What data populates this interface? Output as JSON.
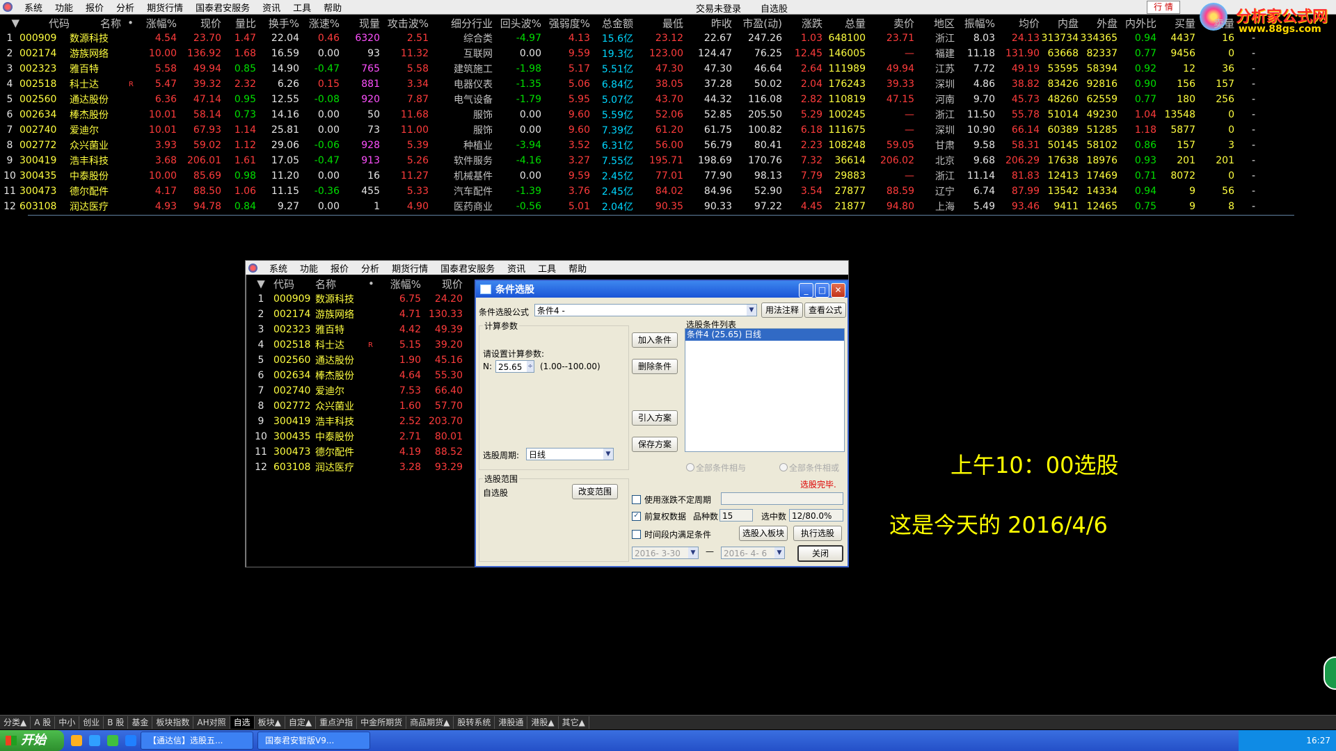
{
  "menubar": {
    "items": [
      "系统",
      "功能",
      "报价",
      "分析",
      "期货行情",
      "国泰君安服务",
      "资讯",
      "工具",
      "帮助"
    ],
    "status_left": "交易未登录",
    "status_right": "自选股",
    "hq_button": "行 情"
  },
  "brand": {
    "title": "分析家公式网",
    "url": "www.88gs.com"
  },
  "main_table": {
    "headers": [
      "",
      "代码",
      "名称",
      "•",
      "涨幅%",
      "现价",
      "量比",
      "换手%",
      "涨速%",
      "现量",
      "攻击波%",
      "细分行业",
      "回头波%",
      "强弱度%",
      "总金额",
      "最低",
      "昨收",
      "市盈(动)",
      "涨跌",
      "总量",
      "卖价",
      "地区",
      "振幅%",
      "均价",
      "内盘",
      "外盘",
      "内外比",
      "买量",
      "卖量",
      ""
    ],
    "rows": [
      [
        "1",
        "000909",
        "数源科技",
        "",
        "4.54",
        "23.70",
        "1.47",
        "22.04",
        "0.46",
        "6320",
        "2.51",
        "综合类",
        "-4.97",
        "4.13",
        "15.6亿",
        "23.12",
        "22.67",
        "247.26",
        "1.03",
        "648100",
        "23.71",
        "浙江",
        "8.03",
        "24.13",
        "313734",
        "334365",
        "0.94",
        "4437",
        "16",
        "-"
      ],
      [
        "2",
        "002174",
        "游族网络",
        "",
        "10.00",
        "136.92",
        "1.68",
        "16.59",
        "0.00",
        "93",
        "11.32",
        "互联网",
        "0.00",
        "9.59",
        "19.3亿",
        "123.00",
        "124.47",
        "76.25",
        "12.45",
        "146005",
        "—",
        "福建",
        "11.18",
        "131.90",
        "63668",
        "82337",
        "0.77",
        "9456",
        "0",
        "-"
      ],
      [
        "3",
        "002323",
        "雅百特",
        "",
        "5.58",
        "49.94",
        "0.85",
        "14.90",
        "-0.47",
        "765",
        "5.58",
        "建筑施工",
        "-1.98",
        "5.17",
        "5.51亿",
        "47.30",
        "47.30",
        "46.64",
        "2.64",
        "111989",
        "49.94",
        "江苏",
        "7.72",
        "49.19",
        "53595",
        "58394",
        "0.92",
        "12",
        "36",
        "-"
      ],
      [
        "4",
        "002518",
        "科士达",
        "R",
        "5.47",
        "39.32",
        "2.32",
        "6.26",
        "0.15",
        "881",
        "3.34",
        "电器仪表",
        "-1.35",
        "5.06",
        "6.84亿",
        "38.05",
        "37.28",
        "50.02",
        "2.04",
        "176243",
        "39.33",
        "深圳",
        "4.86",
        "38.82",
        "83426",
        "92816",
        "0.90",
        "156",
        "157",
        "-"
      ],
      [
        "5",
        "002560",
        "通达股份",
        "",
        "6.36",
        "47.14",
        "0.95",
        "12.55",
        "-0.08",
        "920",
        "7.87",
        "电气设备",
        "-1.79",
        "5.95",
        "5.07亿",
        "43.70",
        "44.32",
        "116.08",
        "2.82",
        "110819",
        "47.15",
        "河南",
        "9.70",
        "45.73",
        "48260",
        "62559",
        "0.77",
        "180",
        "256",
        "-"
      ],
      [
        "6",
        "002634",
        "棒杰股份",
        "",
        "10.01",
        "58.14",
        "0.73",
        "14.16",
        "0.00",
        "50",
        "11.68",
        "服饰",
        "0.00",
        "9.60",
        "5.59亿",
        "52.06",
        "52.85",
        "205.50",
        "5.29",
        "100245",
        "—",
        "浙江",
        "11.50",
        "55.78",
        "51014",
        "49230",
        "1.04",
        "13548",
        "0",
        "-"
      ],
      [
        "7",
        "002740",
        "爱迪尔",
        "",
        "10.01",
        "67.93",
        "1.14",
        "25.81",
        "0.00",
        "73",
        "11.00",
        "服饰",
        "0.00",
        "9.60",
        "7.39亿",
        "61.20",
        "61.75",
        "100.82",
        "6.18",
        "111675",
        "—",
        "深圳",
        "10.90",
        "66.14",
        "60389",
        "51285",
        "1.18",
        "5877",
        "0",
        "-"
      ],
      [
        "8",
        "002772",
        "众兴菌业",
        "",
        "3.93",
        "59.02",
        "1.12",
        "29.06",
        "-0.06",
        "928",
        "5.39",
        "种植业",
        "-3.94",
        "3.52",
        "6.31亿",
        "56.00",
        "56.79",
        "80.41",
        "2.23",
        "108248",
        "59.05",
        "甘肃",
        "9.58",
        "58.31",
        "50145",
        "58102",
        "0.86",
        "157",
        "3",
        "-"
      ],
      [
        "9",
        "300419",
        "浩丰科技",
        "",
        "3.68",
        "206.01",
        "1.61",
        "17.05",
        "-0.47",
        "913",
        "5.26",
        "软件服务",
        "-4.16",
        "3.27",
        "7.55亿",
        "195.71",
        "198.69",
        "170.76",
        "7.32",
        "36614",
        "206.02",
        "北京",
        "9.68",
        "206.29",
        "17638",
        "18976",
        "0.93",
        "201",
        "201",
        "-"
      ],
      [
        "10",
        "300435",
        "中泰股份",
        "",
        "10.00",
        "85.69",
        "0.98",
        "11.20",
        "0.00",
        "16",
        "11.27",
        "机械基件",
        "0.00",
        "9.59",
        "2.45亿",
        "77.01",
        "77.90",
        "98.13",
        "7.79",
        "29883",
        "—",
        "浙江",
        "11.14",
        "81.83",
        "12413",
        "17469",
        "0.71",
        "8072",
        "0",
        "-"
      ],
      [
        "11",
        "300473",
        "德尔配件",
        "",
        "4.17",
        "88.50",
        "1.06",
        "11.15",
        "-0.36",
        "455",
        "5.33",
        "汽车配件",
        "-1.39",
        "3.76",
        "2.45亿",
        "84.02",
        "84.96",
        "52.90",
        "3.54",
        "27877",
        "88.59",
        "辽宁",
        "6.74",
        "87.99",
        "13542",
        "14334",
        "0.94",
        "9",
        "56",
        "-"
      ],
      [
        "12",
        "603108",
        "润达医疗",
        "",
        "4.93",
        "94.78",
        "0.84",
        "9.27",
        "0.00",
        "1",
        "4.90",
        "医药商业",
        "-0.56",
        "5.01",
        "2.04亿",
        "90.35",
        "90.33",
        "97.22",
        "4.45",
        "21877",
        "94.80",
        "上海",
        "5.49",
        "93.46",
        "9411",
        "12465",
        "0.75",
        "9",
        "8",
        "-"
      ]
    ]
  },
  "sub_window": {
    "menu": [
      "系统",
      "功能",
      "报价",
      "分析",
      "期货行情",
      "国泰君安服务",
      "资讯",
      "工具",
      "帮助"
    ],
    "headers": [
      "",
      "代码",
      "名称",
      "•",
      "涨幅%",
      "现价"
    ],
    "rows": [
      [
        "1",
        "000909",
        "数源科技",
        "",
        "6.75",
        "24.20"
      ],
      [
        "2",
        "002174",
        "游族网络",
        "",
        "4.71",
        "130.33"
      ],
      [
        "3",
        "002323",
        "雅百特",
        "",
        "4.42",
        "49.39"
      ],
      [
        "4",
        "002518",
        "科士达",
        "R",
        "5.15",
        "39.20"
      ],
      [
        "5",
        "002560",
        "通达股份",
        "",
        "1.90",
        "45.16"
      ],
      [
        "6",
        "002634",
        "棒杰股份",
        "",
        "4.64",
        "55.30"
      ],
      [
        "7",
        "002740",
        "爱迪尔",
        "",
        "7.53",
        "66.40"
      ],
      [
        "8",
        "002772",
        "众兴菌业",
        "",
        "1.60",
        "57.70"
      ],
      [
        "9",
        "300419",
        "浩丰科技",
        "",
        "2.52",
        "203.70"
      ],
      [
        "10",
        "300435",
        "中泰股份",
        "",
        "2.71",
        "80.01"
      ],
      [
        "11",
        "300473",
        "德尔配件",
        "",
        "4.19",
        "88.52"
      ],
      [
        "12",
        "603108",
        "润达医疗",
        "",
        "3.28",
        "93.29"
      ]
    ]
  },
  "dialog": {
    "title": "条件选股",
    "formula_label": "条件选股公式",
    "formula_value": "条件4        -",
    "usage_button": "用法注释",
    "view_formula_button": "查看公式",
    "calc_params_label": "计算参数",
    "set_params_label": "请设置计算参数:",
    "param_name": "N:",
    "param_value": "25.65",
    "param_range": "(1.00--100.00)",
    "add_condition_button": "加入条件",
    "delete_condition_button": "删除条件",
    "import_scheme_button": "引入方案",
    "save_scheme_button": "保存方案",
    "condition_list_label": "选股条件列表",
    "condition_items": [
      "条件4 (25.65) 日线"
    ],
    "period_label": "选股周期:",
    "period_value": "日线",
    "all_and_label": "全部条件相与",
    "all_or_label": "全部条件相或",
    "done_status": "选股完毕.",
    "range_label": "选股范围",
    "range_value": "自选股",
    "change_range_button": "改变范围",
    "use_unsure_cycle_label": "使用涨跌不定周期",
    "pre_adjust_label": "前复权数据",
    "variety_count_label": "品种数",
    "variety_count_value": "15",
    "selected_count_label": "选中数",
    "selected_count_value": "12/80.0%",
    "time_range_label": "时间段内满足条件",
    "to_block_button": "选股入板块",
    "execute_button": "执行选股",
    "date_from": "2016- 3-30",
    "date_sep": "—",
    "date_to": "2016- 4- 6",
    "close_button": "关闭"
  },
  "annotations": {
    "line1": "上午10：00选股",
    "line2": "这是今天的 2016/4/6"
  },
  "bottom_tabs": [
    "分类▲",
    "A 股",
    "中小",
    "创业",
    "B 股",
    "基金",
    "板块指数",
    "AH对照",
    "自选",
    "板块▲",
    "自定▲",
    "重点沪指",
    "中金所期货",
    "商品期货▲",
    "股转系统",
    "港股通",
    "港股▲",
    "其它▲"
  ],
  "taskbar": {
    "start": "开始",
    "tasks": [
      "【通达信】选股五...",
      "国泰君安智版V9..."
    ],
    "clock": "16:27"
  },
  "colors": {
    "up": "#ff3c3c",
    "down": "#00e000",
    "code": "#ffff40",
    "amount": "#00d8ff",
    "volume_spike": "#ff50ff"
  }
}
